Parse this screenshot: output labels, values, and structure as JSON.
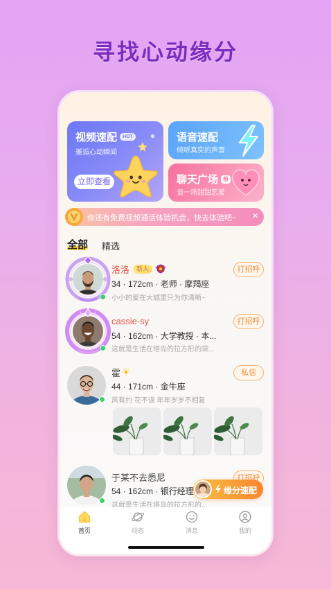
{
  "page": {
    "headline": "寻找心动缘分"
  },
  "features": {
    "video": {
      "title": "视频速配",
      "badge": "HOT",
      "subtitle": "邂逅心动瞬间",
      "button": "立即查看"
    },
    "voice": {
      "title": "语音速配",
      "subtitle": "倾听真实的声音"
    },
    "chat": {
      "title": "聊天广场",
      "badge": "热",
      "subtitle": "谈一场甜甜恋爱"
    }
  },
  "notice": {
    "text": "你还有免费视频通话体验机会，快去体验吧~",
    "close": "×"
  },
  "tabs": [
    {
      "label": "全部",
      "active": true
    },
    {
      "label": "精选",
      "active": false
    }
  ],
  "users": [
    {
      "name": "洛洛",
      "badge": "新人",
      "info": "34 · 172cm · 老师 · 摩羯座",
      "bio": "小小的爱在大城里只为你清晰~",
      "action": "打招呼",
      "online": true
    },
    {
      "name": "cassie-sy",
      "info": "54 · 162cm · 大学教授 · 本...",
      "bio": "这就是生活在塔岛的拉方形的袋...",
      "action": "打招呼",
      "online": true
    },
    {
      "name": "霍",
      "info": "44 · 171cm · 金牛座",
      "bio": "风有约 花不误 年年岁岁不相复",
      "action": "私信",
      "online": true
    },
    {
      "name": "于某不去悉尼",
      "info": "54 · 162cm · 银行经理",
      "bio": "这就是生活在塔岛的拉方形的...",
      "action": "打招呼",
      "online": true
    }
  ],
  "fab": {
    "label": "缘分速配",
    "icon": "lightning-icon"
  },
  "nav": [
    {
      "label": "首页",
      "icon": "home-icon",
      "active": true
    },
    {
      "label": "动态",
      "icon": "planet-icon",
      "active": false
    },
    {
      "label": "消息",
      "icon": "smile-icon",
      "active": false
    },
    {
      "label": "我的",
      "icon": "user-icon",
      "active": false
    }
  ],
  "colors": {
    "headline": "#7a2bc0",
    "name_highlight": "#e5564b",
    "action_button": "#f08c3c",
    "tab_underline": "#fcd34d",
    "online_dot": "#3bd16f",
    "fab": "#f7862f"
  }
}
